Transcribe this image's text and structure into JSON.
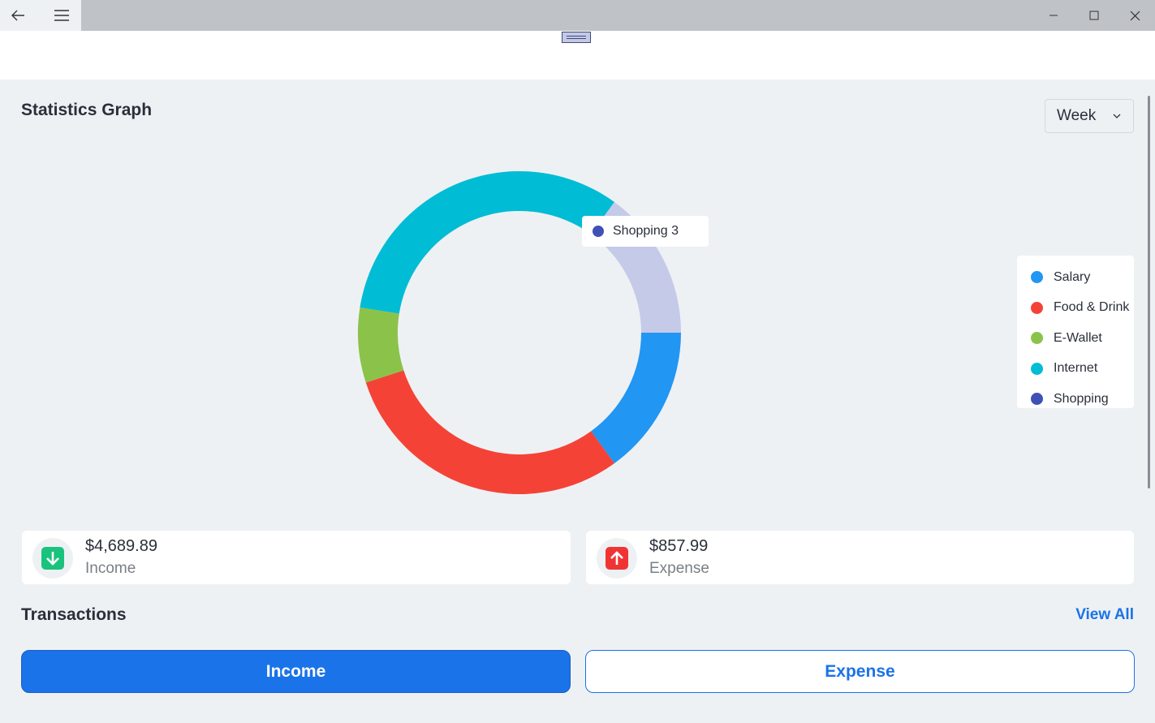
{
  "window": {
    "back_icon": "back-arrow-icon",
    "menu_icon": "hamburger-icon",
    "minimize_icon": "minimize-icon",
    "maximize_icon": "maximize-icon",
    "close_icon": "close-icon"
  },
  "header": {
    "title": "Statistics Graph",
    "period_select": {
      "value": "Week",
      "icon": "chevron-down-icon"
    }
  },
  "chart_data": {
    "type": "pie",
    "style": "donut",
    "slices": [
      {
        "name": "Salary",
        "value": 3,
        "color": "#2196f3"
      },
      {
        "name": "Food & Drink",
        "value": 6,
        "color": "#f44336"
      },
      {
        "name": "E-Wallet",
        "value": 1.5,
        "color": "#8bc34a"
      },
      {
        "name": "Internet",
        "value": 6.5,
        "color": "#00bcd4"
      },
      {
        "name": "Shopping",
        "value": 3,
        "color": "#c5cae9"
      }
    ],
    "tooltip": {
      "label": "Shopping 3",
      "color": "#3f51b5"
    },
    "legend": {
      "position": "right",
      "items": [
        {
          "label": "Salary",
          "color": "#2196f3"
        },
        {
          "label": "Food & Drink",
          "color": "#f44336"
        },
        {
          "label": "E-Wallet",
          "color": "#8bc34a"
        },
        {
          "label": "Internet",
          "color": "#00bcd4"
        },
        {
          "label": "Shopping",
          "color": "#3f51b5"
        }
      ]
    }
  },
  "summary": {
    "income": {
      "amount": "$4,689.89",
      "label": "Income",
      "icon": "arrow-down-icon",
      "color": "#19c37d"
    },
    "expense": {
      "amount": "$857.99",
      "label": "Expense",
      "icon": "arrow-up-icon",
      "color": "#f03434"
    }
  },
  "transactions": {
    "title": "Transactions",
    "view_all": "View All",
    "tabs": [
      {
        "label": "Income",
        "active": true
      },
      {
        "label": "Expense",
        "active": false
      }
    ]
  },
  "colors": {
    "accent": "#1a73e8",
    "background": "#eef1f4"
  }
}
